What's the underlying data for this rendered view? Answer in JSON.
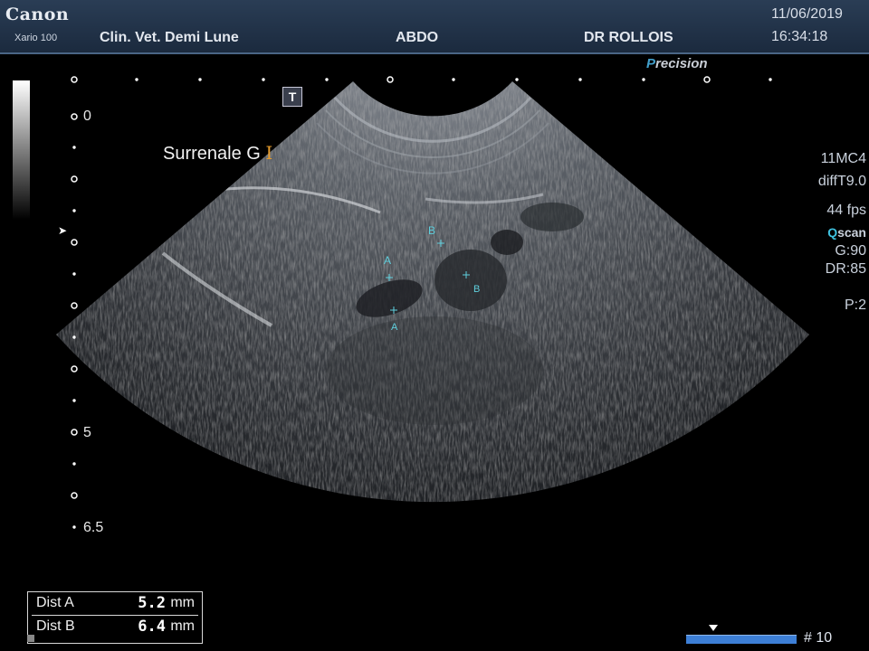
{
  "header": {
    "brand": "Canon",
    "model": "Xario 100",
    "clinic": "Clin. Vet. Demi Lune",
    "exam": "ABDO",
    "doctor": "DR ROLLOIS",
    "date": "11/06/2019",
    "time": "16:34:18"
  },
  "precision": {
    "p": "P",
    "rest": "recision"
  },
  "side_info": {
    "probe": "11MC4",
    "mode": "diffT9.0",
    "fps": "44 fps",
    "qscan_q": "Q",
    "qscan_rest": "scan",
    "gain": "G:90",
    "dr": "DR:85",
    "p": "P:2"
  },
  "annotation": {
    "text": "Surrenale G",
    "cursor": "I"
  },
  "tool_button": "T",
  "depth_scale": {
    "top": "0",
    "mid": "5",
    "bottom": "6.5"
  },
  "focus_marker": "➤",
  "calipers": {
    "a": "A",
    "b": "B"
  },
  "measurements": [
    {
      "label": "Dist A",
      "value": "5.2",
      "unit": "mm"
    },
    {
      "label": "Dist B",
      "value": "6.4",
      "unit": "mm"
    }
  ],
  "frame_number": "# 10",
  "colors": {
    "header_bg": "#22344b",
    "caliper": "#5fd0de",
    "cursor": "#e39a2d",
    "progress": "#3d7fd6"
  }
}
